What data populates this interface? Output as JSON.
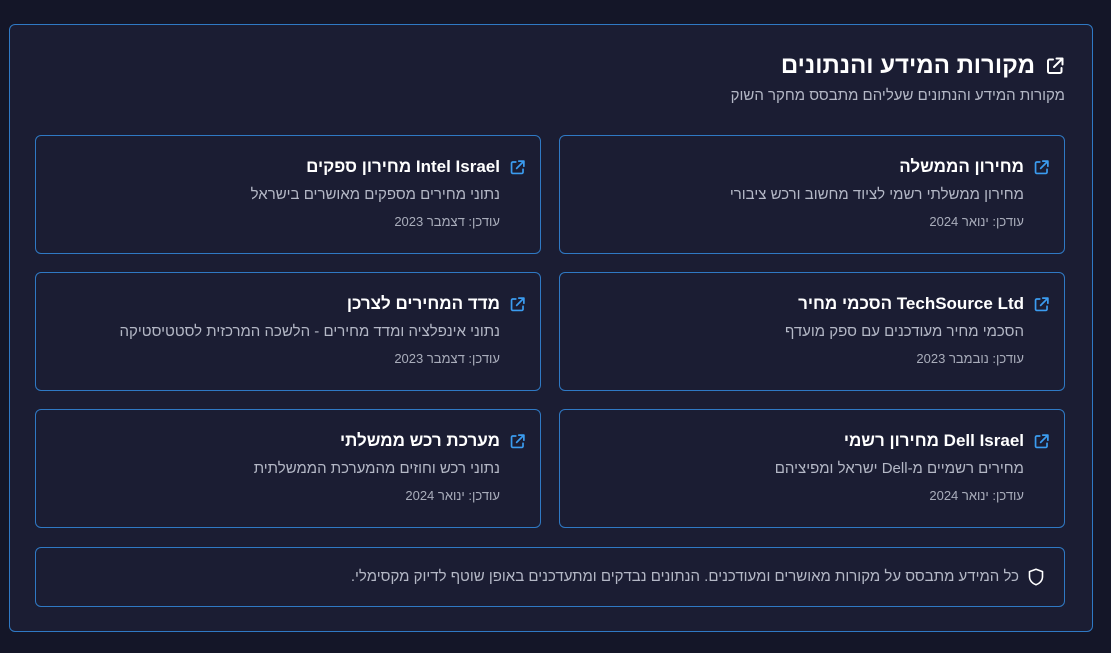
{
  "header": {
    "title": "מקורות המידע והנתונים",
    "subtitle": "מקורות המידע והנתונים שעליהם מתבסס מחקר השוק",
    "icon": "external-link-icon"
  },
  "sources": [
    {
      "title": "מחירון הממשלה",
      "description": "מחירון ממשלתי רשמי לציוד מחשוב ורכש ציבורי",
      "updated": "עודכן: ינואר 2024",
      "icon": "external-link-icon"
    },
    {
      "title": "Intel Israel מחירון ספקים",
      "description": "נתוני מחירים מספקים מאושרים בישראל",
      "updated": "עודכן: דצמבר 2023",
      "icon": "external-link-icon"
    },
    {
      "title": "TechSource Ltd הסכמי מחיר",
      "description": "הסכמי מחיר מעודכנים עם ספק מועדף",
      "updated": "עודכן: נובמבר 2023",
      "icon": "external-link-icon"
    },
    {
      "title": "מדד המחירים לצרכן",
      "description": "נתוני אינפלציה ומדד מחירים - הלשכה המרכזית לסטטיסטיקה",
      "updated": "עודכן: דצמבר 2023",
      "icon": "external-link-icon"
    },
    {
      "title": "Dell Israel מחירון רשמי",
      "description": "מחירים רשמיים מ-Dell ישראל ומפיציהם",
      "updated": "עודכן: ינואר 2024",
      "icon": "external-link-icon"
    },
    {
      "title": "מערכת רכש ממשלתי",
      "description": "נתוני רכש וחוזים מהמערכת הממשלתית",
      "updated": "עודכן: ינואר 2024",
      "icon": "external-link-icon"
    }
  ],
  "footer": {
    "text": "כל המידע מתבסס על מקורות מאושרים ומעודכנים. הנתונים נבדקים ומתעדכנים באופן שוטף לדיוק מקסימלי.",
    "icon": "shield-icon"
  },
  "colors": {
    "background": "#141628",
    "panel": "#1b1d33",
    "border": "#2f79c4",
    "accent": "#3b9cf0",
    "title": "#ffffff",
    "muted": "#b4b8c6"
  }
}
